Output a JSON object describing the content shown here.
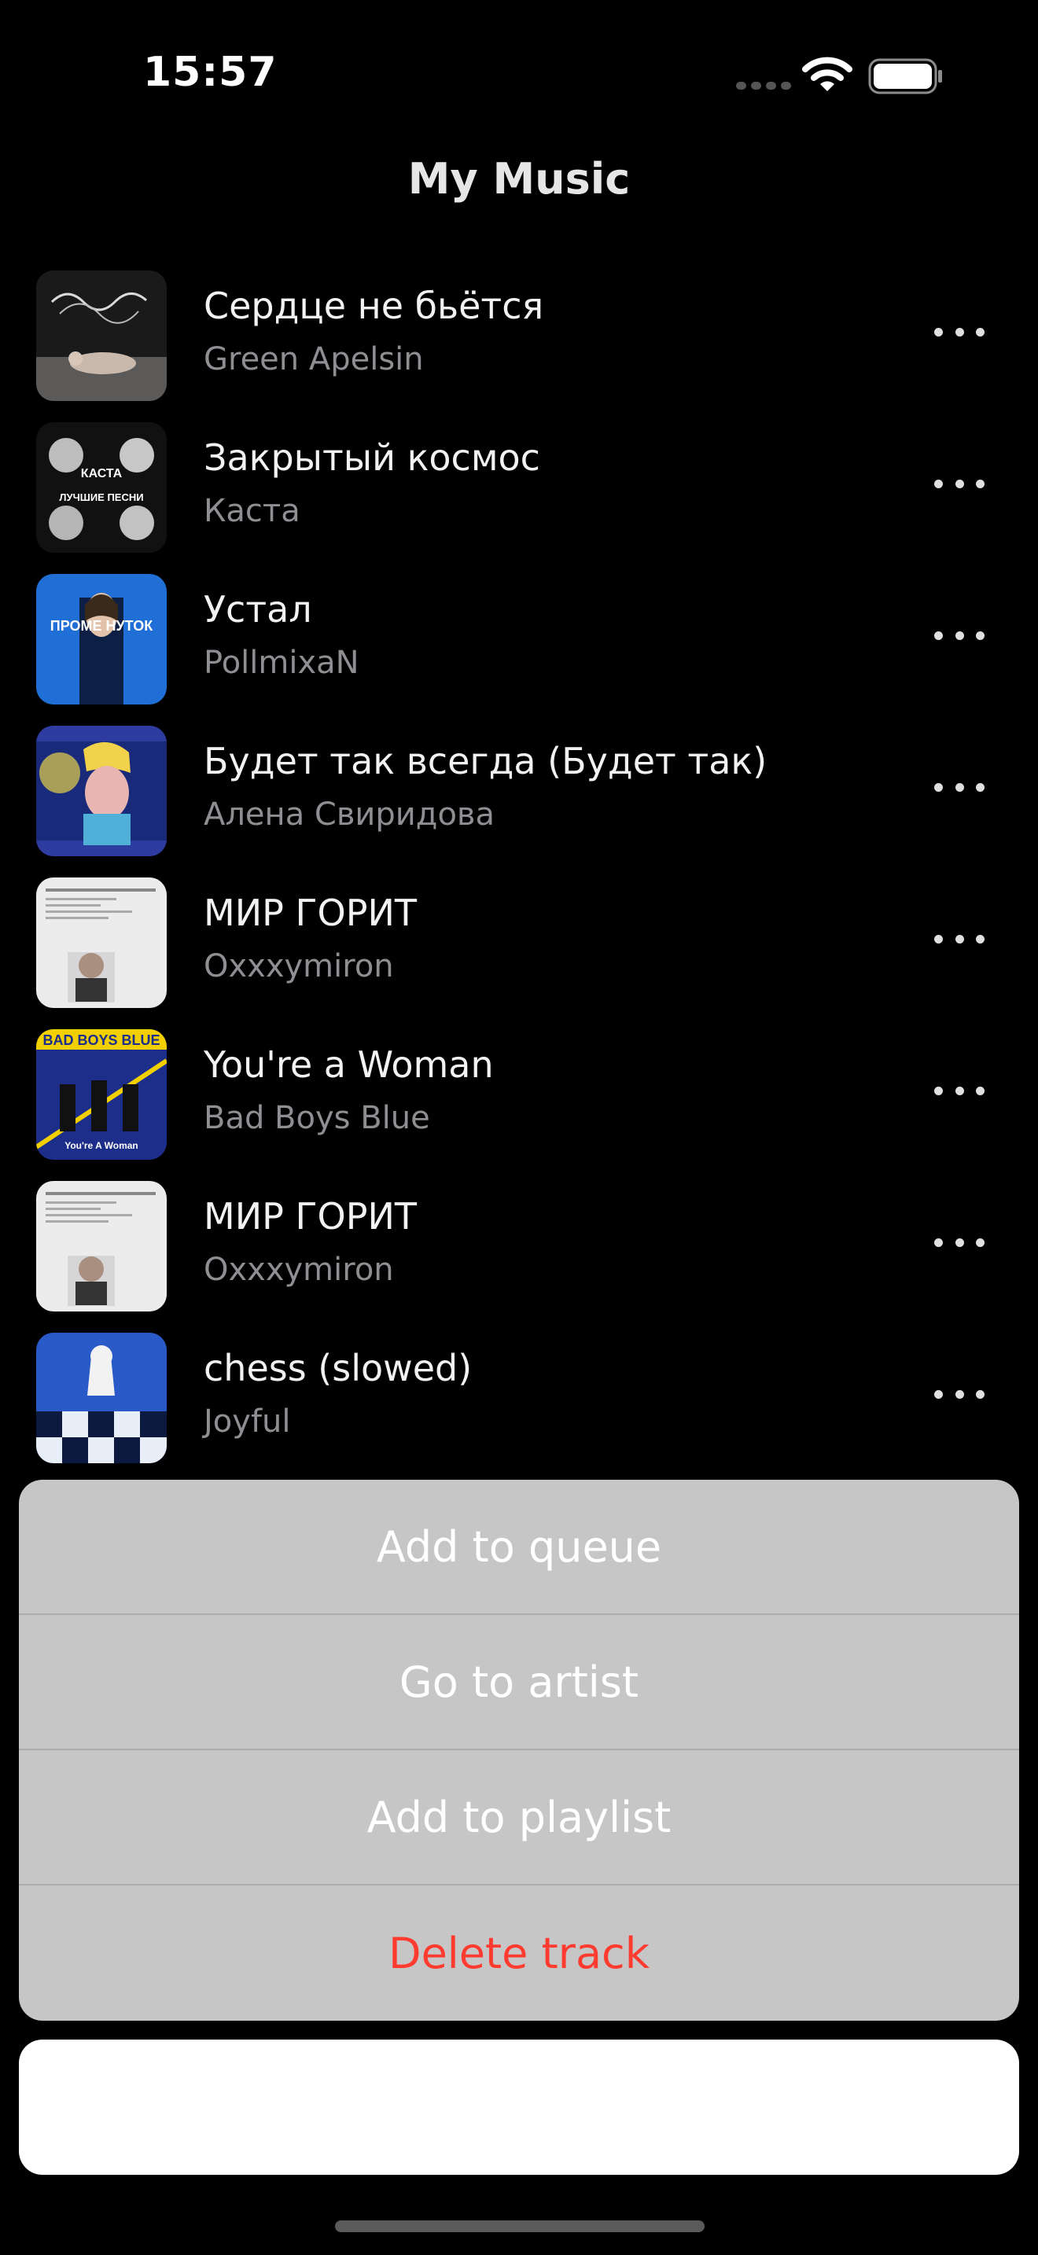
{
  "status_bar": {
    "time": "15:57"
  },
  "nav": {
    "title": "My Music"
  },
  "tracks": [
    {
      "title": "Сердце не бьётся",
      "artist": "Green Apelsin"
    },
    {
      "title": "Закрытый космос",
      "artist": "Каста"
    },
    {
      "title": "Устал",
      "artist": "PollmixaN"
    },
    {
      "title": "Будет так всегда (Будет так)",
      "artist": "Алена Свиридова"
    },
    {
      "title": "МИР ГОРИТ",
      "artist": "Oxxxymiron"
    },
    {
      "title": "You're a Woman",
      "artist": "Bad Boys Blue"
    },
    {
      "title": "МИР ГОРИТ",
      "artist": "Oxxxymiron"
    },
    {
      "title": "chess (slowed)",
      "artist": "Joyful"
    }
  ],
  "cover_text": {
    "kasta_top": "КАСТА",
    "kasta_bottom": "ЛУЧШИЕ ПЕСНИ",
    "pollmixan": "ПРОМЕ  НУТОК",
    "bbb_top": "BAD BOYS BLUE",
    "bbb_bottom": "You're A Woman"
  },
  "action_sheet": {
    "actions": [
      "Add to queue",
      "Go to artist",
      "Add to playlist",
      "Delete track"
    ],
    "destructive_color": "#ff3b30"
  },
  "colors": {
    "background": "#000000",
    "sheet_background": "#c6c6c6",
    "secondary_text": "#8e8e93"
  }
}
